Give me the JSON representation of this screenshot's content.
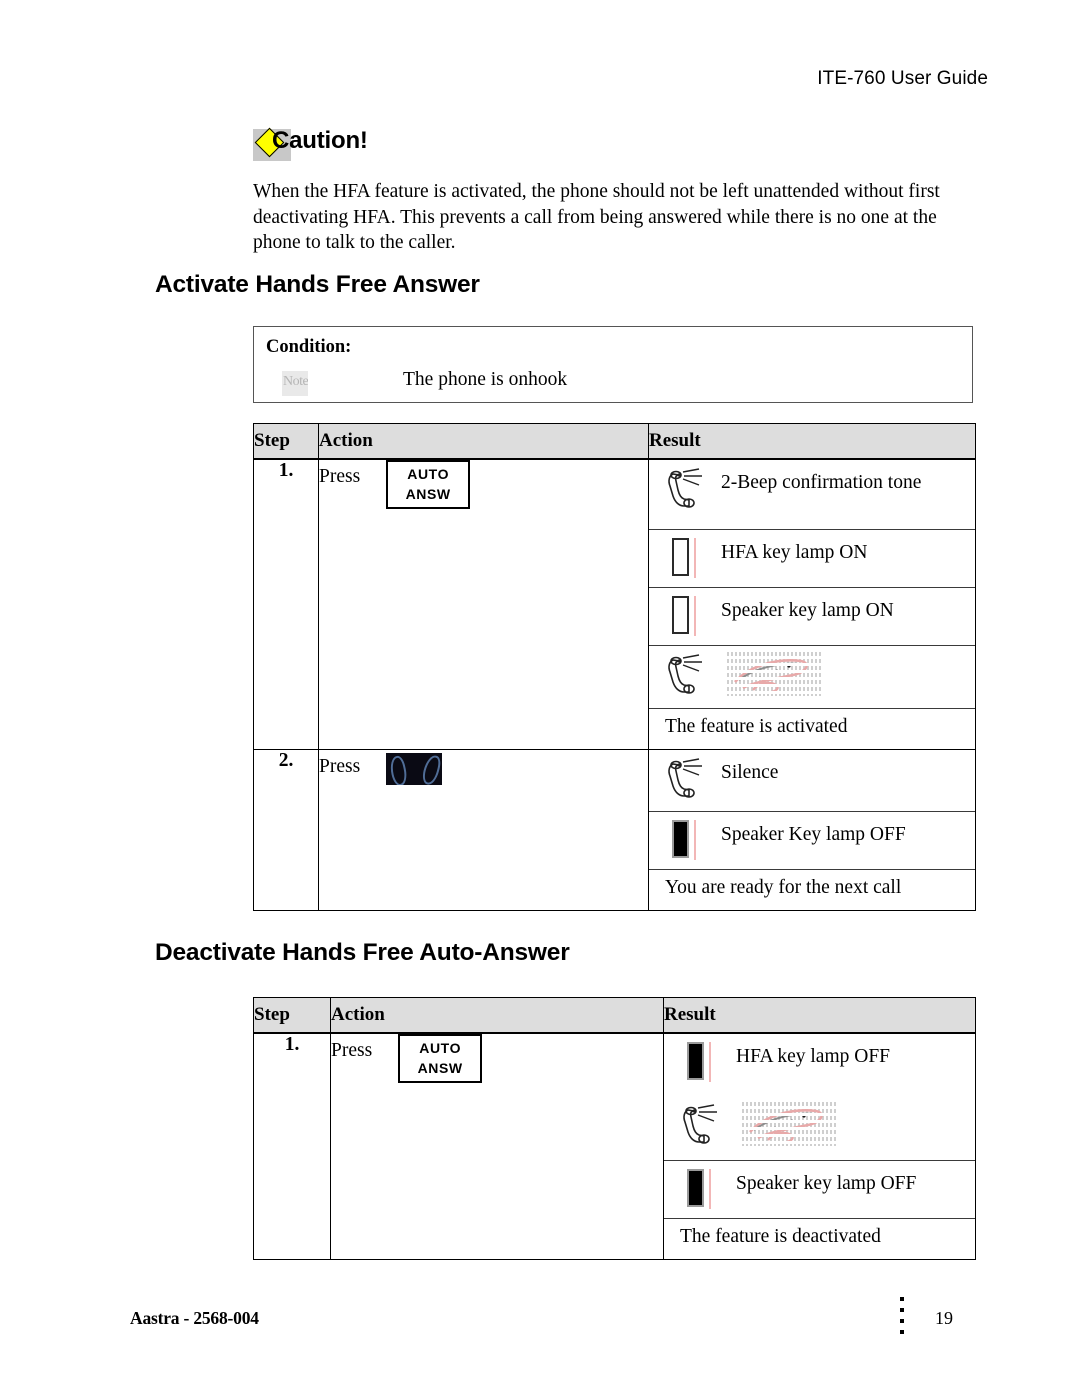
{
  "header": {
    "title": "ITE-760 User Guide"
  },
  "caution": {
    "icon": "caution-diamond-icon",
    "label": "Caution!",
    "body": "When the HFA feature is activated, the phone should not be left unattended without first deactivating HFA. This prevents a call from being answered while there is no one at the phone to talk to the caller."
  },
  "sections": [
    {
      "heading": "Activate Hands Free Answer",
      "condition": {
        "title": "Condition:",
        "icon": "note-icon",
        "icon_text": "Note",
        "text": "The phone is onhook"
      },
      "table": {
        "columns": [
          "Step",
          "Action",
          "Result"
        ],
        "rows": [
          {
            "step": "1.",
            "action": {
              "verb": "Press",
              "key": {
                "line1": "AUTO",
                "line2": "ANSW",
                "icon": "auto-answ-key-icon"
              }
            },
            "results": [
              {
                "icon": "handset-ringing-icon",
                "text": "2-Beep confirmation tone"
              },
              {
                "icon": "lamp-on-icon",
                "text": "HFA key lamp ON"
              },
              {
                "icon": "lamp-on-icon",
                "text": "Speaker key lamp ON"
              },
              {
                "icon": "handset-ringing-icon",
                "extra_icon": "scribble-graphic",
                "text": ""
              },
              {
                "icon": "",
                "text": "The feature is activated"
              }
            ]
          },
          {
            "step": "2.",
            "action": {
              "verb": "Press",
              "key": {
                "line1": "",
                "line2": "",
                "icon": "dark-key-icon"
              }
            },
            "results": [
              {
                "icon": "handset-ringing-icon",
                "text": "Silence"
              },
              {
                "icon": "lamp-off-icon",
                "text": "Speaker Key lamp OFF"
              },
              {
                "icon": "",
                "text": "You are ready for the next call"
              }
            ]
          }
        ]
      }
    },
    {
      "heading": "Deactivate Hands Free Auto-Answer",
      "table": {
        "columns": [
          "Step",
          "Action",
          "Result"
        ],
        "rows": [
          {
            "step": "1.",
            "action": {
              "verb": "Press",
              "key": {
                "line1": "AUTO",
                "line2": "ANSW",
                "icon": "auto-answ-key-icon"
              }
            },
            "results": [
              {
                "icon": "lamp-off-icon",
                "text": "HFA key lamp OFF"
              },
              {
                "icon": "handset-ringing-icon",
                "extra_icon": "scribble-graphic",
                "text": ""
              },
              {
                "icon": "lamp-off-icon",
                "text": "Speaker key lamp OFF"
              },
              {
                "icon": "",
                "text": "The feature is deactivated"
              }
            ]
          }
        ]
      }
    }
  ],
  "footer": {
    "left": "Aastra - 2568-004",
    "page": "19"
  },
  "colors": {
    "caution_diamond": "#ffff00",
    "table_header_bg": "#dddddd",
    "lamp_pin": "#f2b6b6",
    "scribble_pink": "#f0b8b8"
  }
}
